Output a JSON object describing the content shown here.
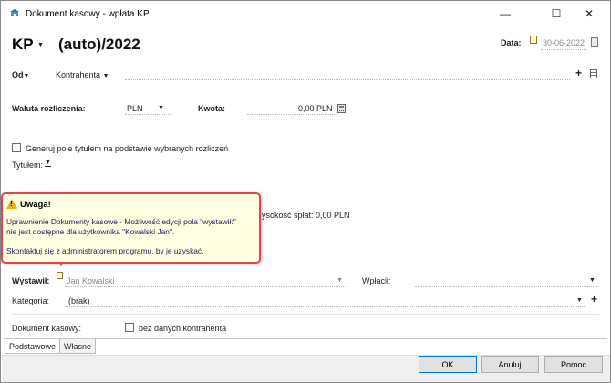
{
  "window": {
    "title": "Dokument kasowy - wpłata KP",
    "controls": {
      "minimize": "—",
      "maximize": "☐",
      "close": "✕"
    }
  },
  "header": {
    "doc_type": "KP",
    "doc_number": "(auto)/2022",
    "date_label": "Data:",
    "date_value": "30-06-2022"
  },
  "od": {
    "label": "Od",
    "value": "Kontrahenta"
  },
  "waluta": {
    "label": "Waluta rozliczenia:",
    "value": "PLN"
  },
  "kwota": {
    "label": "Kwota:",
    "value": "0,00 PLN"
  },
  "generuj": {
    "label": "Generuj pole tytułem na podstawie wybranych rozliczeń"
  },
  "tytulem": {
    "label": "Tytułem:"
  },
  "behind_text": "ysokość spłat: 0,00 PLN",
  "tooltip": {
    "title": "Uwaga!",
    "line1": "Uprawnienie Dokumenty kasowe - Możliwość edycji pola \"wystawił:\"",
    "line2": "nie jest dostępne dla użytkownika \"Kowalski Jan\".",
    "line3": "Skontaktuj się z administratorem programu, by je uzyskać."
  },
  "wystawil": {
    "label": "Wystawił:",
    "value": "Jan Kowalski"
  },
  "wplacil": {
    "label": "Wpłacił:"
  },
  "kategoria": {
    "label": "Kategoria:",
    "value": "(brak)"
  },
  "dokument_kasowy": {
    "label": "Dokument kasowy:",
    "checkbox_label": "bez danych kontrahenta"
  },
  "tabs": [
    {
      "label": "Podstawowe",
      "active": true
    },
    {
      "label": "Własne",
      "active": false
    }
  ],
  "buttons": {
    "ok": "OK",
    "cancel": "Anuluj",
    "help": "Pomoc"
  },
  "icons": {
    "app": "app-icon",
    "calendar": "calendar-icon",
    "warning": "warning-icon",
    "add": "plus-icon",
    "list": "list-icon",
    "calculator": "calculator-icon"
  },
  "colors": {
    "tooltip_bg": "#ffffe1",
    "tooltip_border": "#e0454c",
    "default_button_border": "#0078d7"
  }
}
